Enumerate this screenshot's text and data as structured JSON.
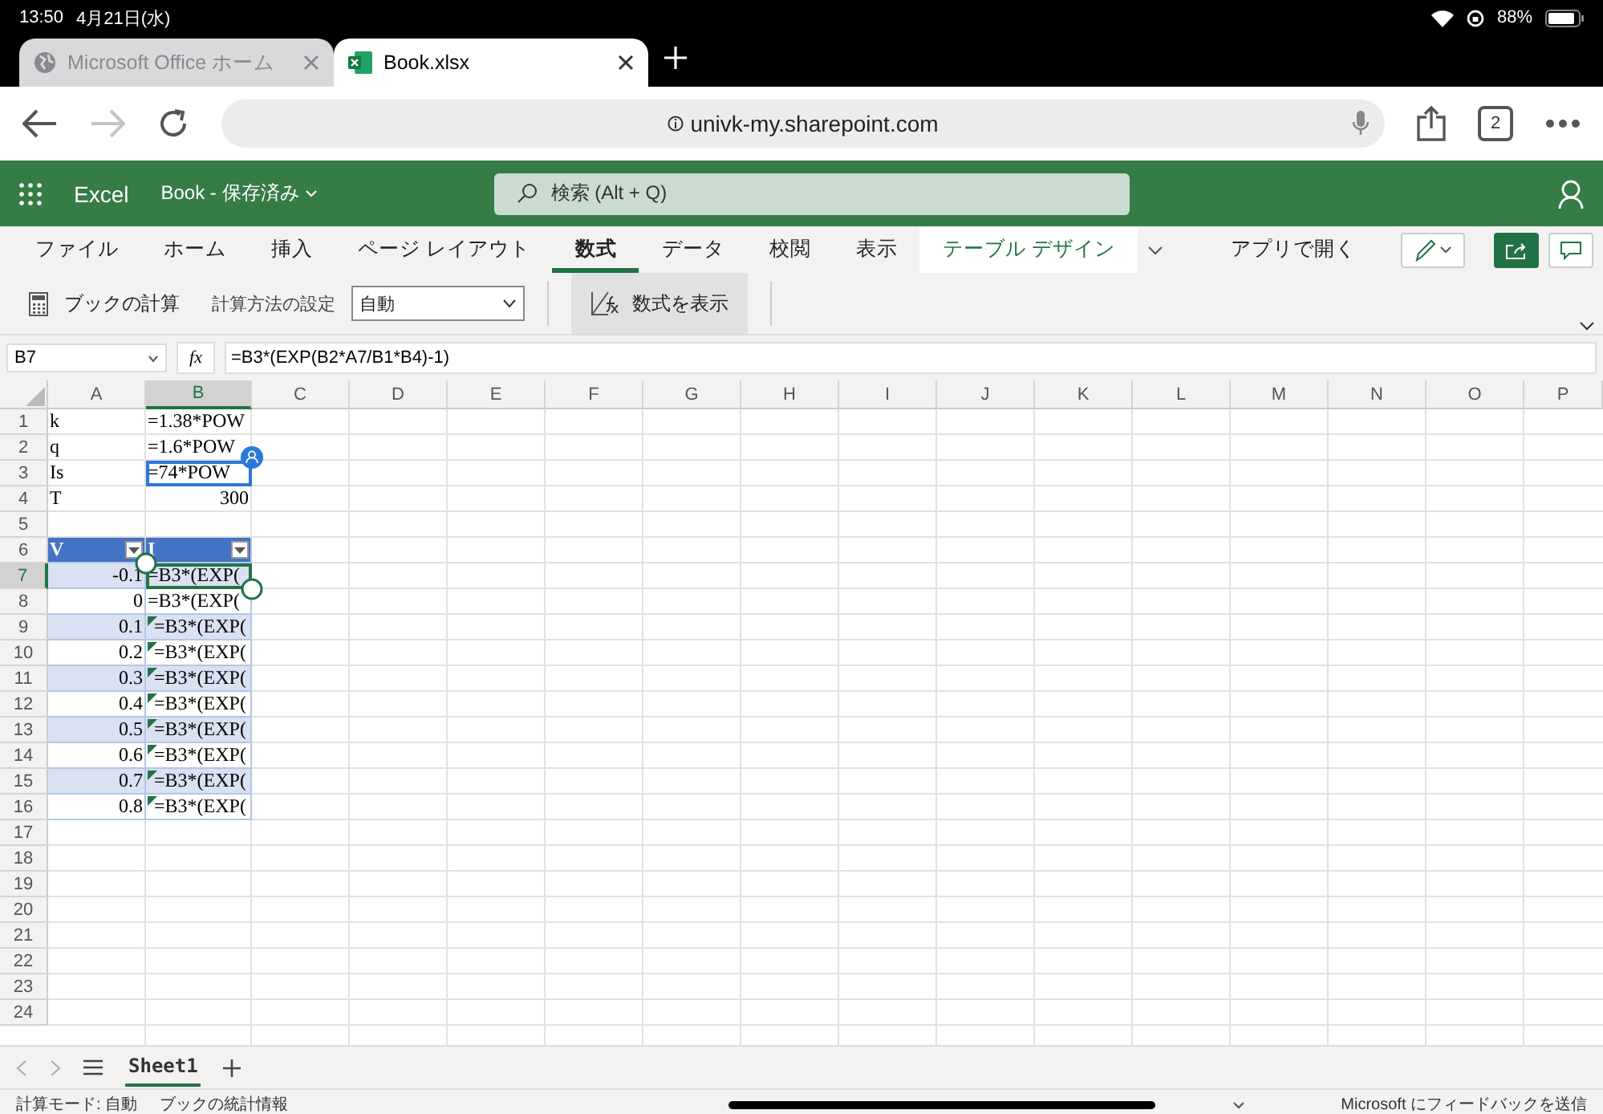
{
  "status_bar": {
    "time": "13:50",
    "date": "4月21日(水)",
    "battery": "88%"
  },
  "browser_tabs": [
    {
      "title": "Microsoft Office ホーム",
      "kind": "globe",
      "selected": false
    },
    {
      "title": "Book.xlsx",
      "kind": "excel",
      "selected": true
    }
  ],
  "address_bar": {
    "url": "univk-my.sharepoint.com"
  },
  "tab_count": "2",
  "app_header": {
    "app": "Excel",
    "document": "Book - 保存済み",
    "search_placeholder": "検索 (Alt + Q)"
  },
  "ribbon_tabs": [
    {
      "label": "ファイル",
      "kind": "normal",
      "selected": false
    },
    {
      "label": "ホーム",
      "kind": "normal",
      "selected": false
    },
    {
      "label": "挿入",
      "kind": "normal",
      "selected": false
    },
    {
      "label": "ページ レイアウト",
      "kind": "normal",
      "selected": false
    },
    {
      "label": "数式",
      "kind": "normal",
      "selected": true
    },
    {
      "label": "データ",
      "kind": "normal",
      "selected": false
    },
    {
      "label": "校閲",
      "kind": "normal",
      "selected": false
    },
    {
      "label": "表示",
      "kind": "normal",
      "selected": false
    },
    {
      "label": "テーブル デザイン",
      "kind": "contextual",
      "selected": false
    }
  ],
  "open_in_app": "アプリで開く",
  "ribbon": {
    "calc_workbook": "ブックの計算",
    "calc_options_label": "計算方法の設定",
    "calc_options_value": "自動",
    "show_formulas": "数式を表示"
  },
  "formula_bar": {
    "name_box": "B7",
    "fx": "fx",
    "formula": "=B3*(EXP(B2*A7/B1*B4)-1)"
  },
  "grid": {
    "columns": [
      {
        "label": "A",
        "selected": false
      },
      {
        "label": "B",
        "selected": true
      },
      {
        "label": "C",
        "selected": false
      },
      {
        "label": "D",
        "selected": false
      },
      {
        "label": "E",
        "selected": false
      },
      {
        "label": "F",
        "selected": false
      },
      {
        "label": "G",
        "selected": false
      },
      {
        "label": "H",
        "selected": false
      },
      {
        "label": "I",
        "selected": false
      },
      {
        "label": "J",
        "selected": false
      },
      {
        "label": "K",
        "selected": false
      },
      {
        "label": "L",
        "selected": false
      },
      {
        "label": "M",
        "selected": false
      },
      {
        "label": "N",
        "selected": false
      },
      {
        "label": "O",
        "selected": false
      },
      {
        "label": "P",
        "selected": false
      }
    ],
    "rows": [
      {
        "label": "1",
        "kind": "plain",
        "selected": false,
        "cells": [
          {
            "text": "k",
            "kind": "text",
            "selected": false,
            "warning": false
          },
          {
            "text": "=1.38*POW",
            "kind": "text",
            "selected": false,
            "warning": false
          }
        ]
      },
      {
        "label": "2",
        "kind": "plain",
        "selected": false,
        "cells": [
          {
            "text": "q",
            "kind": "text",
            "selected": false,
            "warning": false
          },
          {
            "text": "=1.6*POW",
            "kind": "text",
            "selected": false,
            "warning": false
          }
        ]
      },
      {
        "label": "3",
        "kind": "plain",
        "selected": false,
        "cells": [
          {
            "text": "Is",
            "kind": "text",
            "selected": false,
            "warning": false
          },
          {
            "text": "=74*POW",
            "kind": "text",
            "selected": false,
            "warning": false,
            "comment": true
          }
        ]
      },
      {
        "label": "4",
        "kind": "plain",
        "selected": false,
        "cells": [
          {
            "text": "T",
            "kind": "text",
            "selected": false,
            "warning": false
          },
          {
            "text": "300",
            "kind": "number",
            "selected": false,
            "warning": false
          }
        ]
      },
      {
        "label": "5",
        "kind": "plain",
        "selected": false,
        "cells": []
      },
      {
        "label": "6",
        "kind": "table_header",
        "selected": false,
        "cells": [
          {
            "text": "V",
            "kind": "text",
            "selected": false,
            "warning": false
          },
          {
            "text": "I",
            "kind": "text",
            "selected": false,
            "warning": false
          }
        ]
      },
      {
        "label": "7",
        "kind": "table_band",
        "selected": true,
        "cells": [
          {
            "text": "-0.1",
            "kind": "number",
            "selected": false,
            "warning": false
          },
          {
            "text": "=B3*(EXP(",
            "kind": "text",
            "selected": true,
            "warning": false
          }
        ]
      },
      {
        "label": "8",
        "kind": "table_row",
        "selected": false,
        "cells": [
          {
            "text": "0",
            "kind": "number",
            "selected": false,
            "warning": false
          },
          {
            "text": "=B3*(EXP(",
            "kind": "text",
            "selected": false,
            "warning": false
          }
        ]
      },
      {
        "label": "9",
        "kind": "table_band",
        "selected": false,
        "cells": [
          {
            "text": "0.1",
            "kind": "number",
            "selected": false,
            "warning": false
          },
          {
            "text": "=B3*(EXP(",
            "kind": "text",
            "selected": false,
            "warning": true
          }
        ]
      },
      {
        "label": "10",
        "kind": "table_row",
        "selected": false,
        "cells": [
          {
            "text": "0.2",
            "kind": "number",
            "selected": false,
            "warning": false
          },
          {
            "text": "=B3*(EXP(",
            "kind": "text",
            "selected": false,
            "warning": true
          }
        ]
      },
      {
        "label": "11",
        "kind": "table_band",
        "selected": false,
        "cells": [
          {
            "text": "0.3",
            "kind": "number",
            "selected": false,
            "warning": false
          },
          {
            "text": "=B3*(EXP(",
            "kind": "text",
            "selected": false,
            "warning": true
          }
        ]
      },
      {
        "label": "12",
        "kind": "table_row",
        "selected": false,
        "cells": [
          {
            "text": "0.4",
            "kind": "number",
            "selected": false,
            "warning": false
          },
          {
            "text": "=B3*(EXP(",
            "kind": "text",
            "selected": false,
            "warning": true
          }
        ]
      },
      {
        "label": "13",
        "kind": "table_band",
        "selected": false,
        "cells": [
          {
            "text": "0.5",
            "kind": "number",
            "selected": false,
            "warning": false
          },
          {
            "text": "=B3*(EXP(",
            "kind": "text",
            "selected": false,
            "warning": true
          }
        ]
      },
      {
        "label": "14",
        "kind": "table_row",
        "selected": false,
        "cells": [
          {
            "text": "0.6",
            "kind": "number",
            "selected": false,
            "warning": false
          },
          {
            "text": "=B3*(EXP(",
            "kind": "text",
            "selected": false,
            "warning": true
          }
        ]
      },
      {
        "label": "15",
        "kind": "table_band",
        "selected": false,
        "cells": [
          {
            "text": "0.7",
            "kind": "number",
            "selected": false,
            "warning": false
          },
          {
            "text": "=B3*(EXP(",
            "kind": "text",
            "selected": false,
            "warning": true
          }
        ]
      },
      {
        "label": "16",
        "kind": "table_row",
        "selected": false,
        "cells": [
          {
            "text": "0.8",
            "kind": "number",
            "selected": false,
            "warning": false
          },
          {
            "text": "=B3*(EXP(",
            "kind": "text",
            "selected": false,
            "warning": true
          }
        ]
      },
      {
        "label": "17",
        "kind": "plain",
        "selected": false,
        "cells": []
      },
      {
        "label": "18",
        "kind": "plain",
        "selected": false,
        "cells": []
      },
      {
        "label": "19",
        "kind": "plain",
        "selected": false,
        "cells": []
      },
      {
        "label": "20",
        "kind": "plain",
        "selected": false,
        "cells": []
      },
      {
        "label": "21",
        "kind": "plain",
        "selected": false,
        "cells": []
      },
      {
        "label": "22",
        "kind": "plain",
        "selected": false,
        "cells": []
      },
      {
        "label": "23",
        "kind": "plain",
        "selected": false,
        "cells": []
      },
      {
        "label": "24",
        "kind": "plain",
        "selected": false,
        "cells": []
      }
    ]
  },
  "sheet_tabs": [
    {
      "label": "Sheet1",
      "selected": true
    }
  ],
  "app_status": {
    "calc_mode": "計算モード: 自動",
    "stats": "ブックの統計情報",
    "feedback": "Microsoft にフィードバックを送信"
  }
}
